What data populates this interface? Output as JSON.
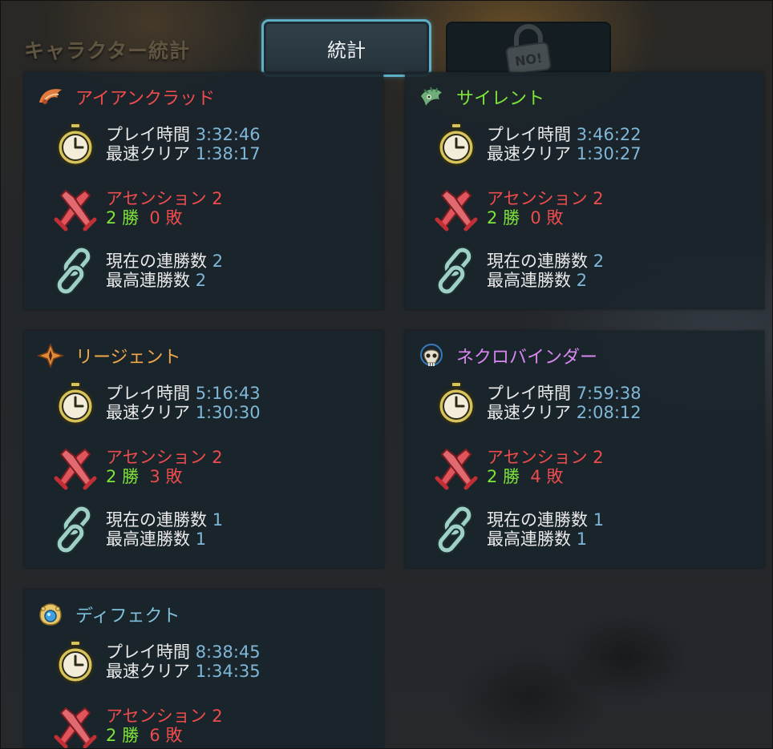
{
  "header": {
    "title": "キャラクター統計",
    "tab_stats_label": "統計",
    "tab_locked_text": "NO!"
  },
  "labels": {
    "playtime": "プレイ時間",
    "fastest": "最速クリア",
    "ascension": "アセンション",
    "wins_suffix": "勝",
    "losses_suffix": "敗",
    "current_streak": "現在の連勝数",
    "best_streak": "最高連勝数"
  },
  "characters": [
    {
      "name": "アイアンクラッド",
      "icon": "ironclad-icon",
      "playtime": "3:32:46",
      "fastest": "1:38:17",
      "ascension": "2",
      "wins": "2",
      "losses": "0",
      "current_streak": "2",
      "best_streak": "2"
    },
    {
      "name": "サイレント",
      "icon": "silent-icon",
      "playtime": "3:46:22",
      "fastest": "1:30:27",
      "ascension": "2",
      "wins": "2",
      "losses": "0",
      "current_streak": "2",
      "best_streak": "2"
    },
    {
      "name": "リージェント",
      "icon": "regent-icon",
      "playtime": "5:16:43",
      "fastest": "1:30:30",
      "ascension": "2",
      "wins": "2",
      "losses": "3",
      "current_streak": "1",
      "best_streak": "1"
    },
    {
      "name": "ネクロバインダー",
      "icon": "necrobinder-icon",
      "playtime": "7:59:38",
      "fastest": "2:08:12",
      "ascension": "2",
      "wins": "2",
      "losses": "4",
      "current_streak": "1",
      "best_streak": "1"
    },
    {
      "name": "ディフェクト",
      "icon": "defect-icon",
      "playtime": "8:38:45",
      "fastest": "1:34:35",
      "ascension": "2",
      "wins": "2",
      "losses": "6"
    }
  ],
  "colors": {
    "accent": "#5fb0c6",
    "value": "#7fb7d8",
    "wins": "#7fe53a",
    "losses": "#ee4c4c",
    "panel": "#1a252b"
  }
}
